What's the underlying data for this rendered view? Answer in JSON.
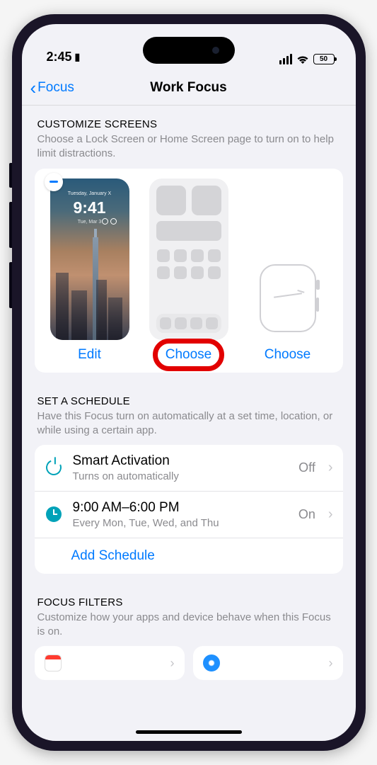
{
  "status": {
    "time": "2:45",
    "battery": "50"
  },
  "nav": {
    "back": "Focus",
    "title": "Work Focus"
  },
  "customize": {
    "header": "CUSTOMIZE SCREENS",
    "desc": "Choose a Lock Screen or Home Screen page to turn on to help limit distractions.",
    "lock": {
      "date": "Tuesday, January X",
      "time": "9:41",
      "widgets": "Tue, Mar 3"
    },
    "actions": {
      "edit": "Edit",
      "choose_home": "Choose",
      "choose_watch": "Choose"
    }
  },
  "schedule": {
    "header": "SET A SCHEDULE",
    "desc": "Have this Focus turn on automatically at a set time, location, or while using a certain app.",
    "smart": {
      "title": "Smart Activation",
      "sub": "Turns on automatically",
      "status": "Off"
    },
    "time": {
      "title": "9:00 AM–6:00 PM",
      "sub": "Every Mon, Tue, Wed, and Thu",
      "status": "On"
    },
    "add": "Add Schedule"
  },
  "filters": {
    "header": "FOCUS FILTERS",
    "desc": "Customize how your apps and device behave when this Focus is on."
  }
}
